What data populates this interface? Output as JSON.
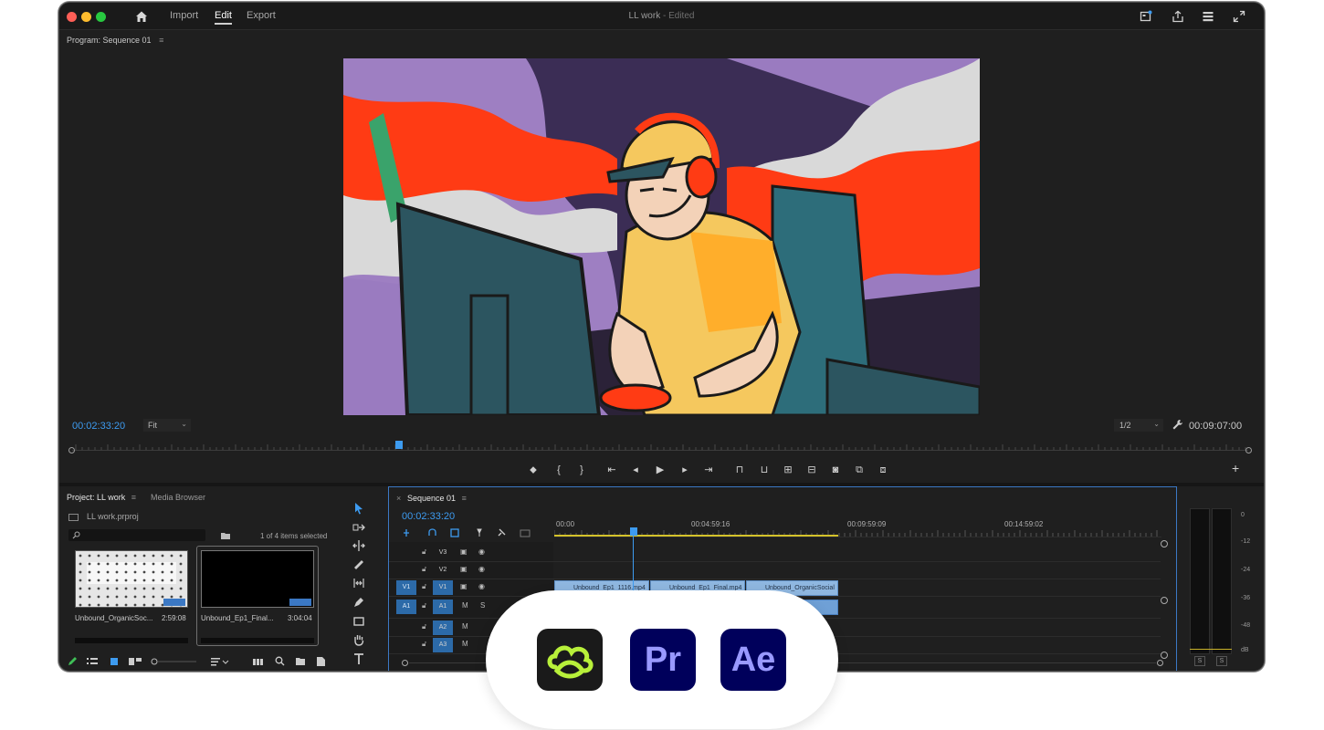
{
  "titlebar": {
    "menu": [
      "Import",
      "Edit",
      "Export"
    ],
    "active_menu": "Edit",
    "doc_title": "LL work",
    "doc_status": "- Edited"
  },
  "program_monitor": {
    "title": "Program: Sequence 01",
    "menu_glyph": "≡",
    "timecode_current": "00:02:33:20",
    "zoom": "Fit",
    "resolution": "1/2",
    "timecode_duration": "00:09:07:00"
  },
  "project": {
    "tab_active": "Project: LL work",
    "tab_menu": "≡",
    "tab_other": "Media Browser",
    "file": "LL work.prproj",
    "count": "1 of 4 items selected",
    "items": [
      {
        "name": "Unbound_OrganicSoc...",
        "duration": "2:59:08"
      },
      {
        "name": "Unbound_Ep1_Final...",
        "duration": "3:04:04"
      }
    ]
  },
  "timeline": {
    "tab": "Sequence 01",
    "tab_menu": "≡",
    "timecode": "00:02:33:20",
    "ruler": [
      "00:00",
      "00:04:59:16",
      "00:09:59:09",
      "00:14:59:02"
    ],
    "tracks": [
      {
        "src": "",
        "name": "V3"
      },
      {
        "src": "",
        "name": "V2"
      },
      {
        "src": "V1",
        "name": "V1"
      },
      {
        "src": "A1",
        "name": "A1"
      },
      {
        "src": "",
        "name": "A2"
      },
      {
        "src": "",
        "name": "A3"
      }
    ],
    "clips": [
      "Unbound_Ep1_1116.mp4",
      "Unbound_Ep1_Final.mp4",
      "Unbound_OrganicSocial"
    ],
    "mute_label": "M",
    "solo_label": "S"
  },
  "meters": {
    "scale": [
      "0",
      "-12",
      "-24",
      "-36",
      "-48",
      "dB"
    ],
    "solo": [
      "S",
      "S"
    ]
  },
  "badge": {
    "apps": [
      {
        "label": "",
        "icon": "frame-io-icon",
        "color": "#b8f03a"
      },
      {
        "label": "Pr",
        "icon": "premiere-pro-icon",
        "color": "#9999ff"
      },
      {
        "label": "Ae",
        "icon": "after-effects-icon",
        "color": "#9999ff"
      }
    ]
  },
  "colors": {
    "accent_blue": "#3d9bf0",
    "work_area_yellow": "#d4c22a",
    "clip_blue": "#8fb7e0"
  }
}
